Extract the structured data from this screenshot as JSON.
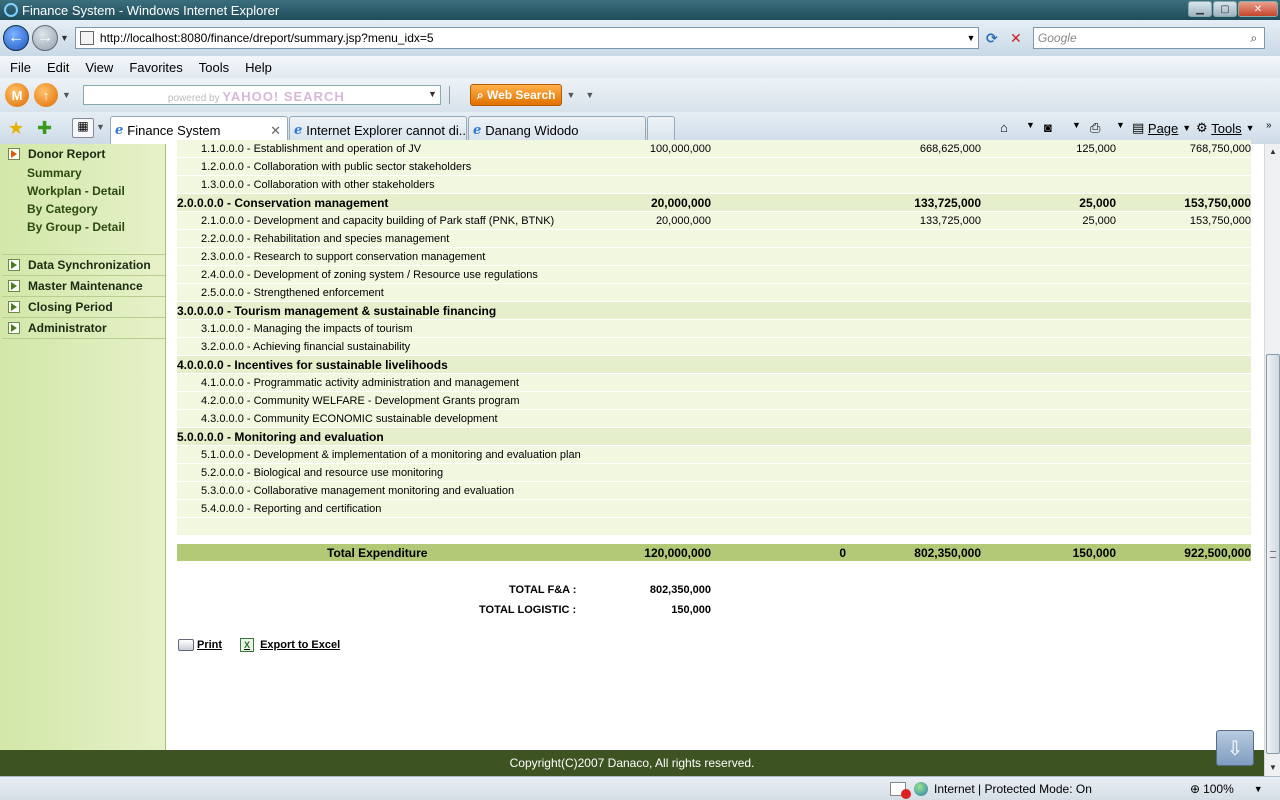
{
  "window": {
    "title": "Finance System - Windows Internet Explorer",
    "url": "http://localhost:8080/finance/dreport/summary.jsp?menu_idx=5",
    "search_placeholder": "Google"
  },
  "menu": [
    "File",
    "Edit",
    "View",
    "Favorites",
    "Tools",
    "Help"
  ],
  "yahoo": {
    "powered_by": "powered by",
    "brand": "YAHOO! SEARCH",
    "web_search": "Web Search"
  },
  "tabs": [
    {
      "label": "Finance System",
      "active": true
    },
    {
      "label": "Internet Explorer cannot di...",
      "active": false
    },
    {
      "label": "Danang Widodo",
      "active": false
    }
  ],
  "commands": {
    "page": "Page",
    "tools": "Tools"
  },
  "sidebar": {
    "donor_report": "Donor Report",
    "sub_items": [
      "Summary",
      "Workplan - Detail",
      "By Category",
      "By Group - Detail"
    ],
    "sections": [
      "Data Synchronization",
      "Master Maintenance",
      "Closing Period",
      "Administrator"
    ]
  },
  "report": {
    "rows": [
      {
        "type": "item",
        "label": "1.1.0.0.0 - Establishment and operation of JV",
        "c1": "100,000,000",
        "c2": "",
        "c3": "668,625,000",
        "c4": "125,000",
        "c5": "768,750,000"
      },
      {
        "type": "item",
        "label": "1.2.0.0.0 - Collaboration with public sector stakeholders",
        "c1": "",
        "c2": "",
        "c3": "",
        "c4": "",
        "c5": ""
      },
      {
        "type": "item",
        "label": "1.3.0.0.0 - Collaboration with other stakeholders",
        "c1": "",
        "c2": "",
        "c3": "",
        "c4": "",
        "c5": ""
      },
      {
        "type": "group",
        "label": "2.0.0.0.0 - Conservation management",
        "c1": "20,000,000",
        "c2": "",
        "c3": "133,725,000",
        "c4": "25,000",
        "c5": "153,750,000"
      },
      {
        "type": "item",
        "label": "2.1.0.0.0 - Development and capacity building of Park staff (PNK, BTNK)",
        "c1": "20,000,000",
        "c2": "",
        "c3": "133,725,000",
        "c4": "25,000",
        "c5": "153,750,000"
      },
      {
        "type": "item",
        "label": "2.2.0.0.0 - Rehabilitation and species management",
        "c1": "",
        "c2": "",
        "c3": "",
        "c4": "",
        "c5": ""
      },
      {
        "type": "item",
        "label": "2.3.0.0.0 - Research to support conservation management",
        "c1": "",
        "c2": "",
        "c3": "",
        "c4": "",
        "c5": ""
      },
      {
        "type": "item",
        "label": "2.4.0.0.0 - Development of zoning system / Resource use regulations",
        "c1": "",
        "c2": "",
        "c3": "",
        "c4": "",
        "c5": ""
      },
      {
        "type": "item",
        "label": "2.5.0.0.0 - Strengthened enforcement",
        "c1": "",
        "c2": "",
        "c3": "",
        "c4": "",
        "c5": ""
      },
      {
        "type": "group",
        "label": "3.0.0.0.0 - Tourism management & sustainable financing",
        "c1": "",
        "c2": "",
        "c3": "",
        "c4": "",
        "c5": ""
      },
      {
        "type": "item",
        "label": "3.1.0.0.0 - Managing the impacts of tourism",
        "c1": "",
        "c2": "",
        "c3": "",
        "c4": "",
        "c5": ""
      },
      {
        "type": "item",
        "label": "3.2.0.0.0 - Achieving financial sustainability",
        "c1": "",
        "c2": "",
        "c3": "",
        "c4": "",
        "c5": ""
      },
      {
        "type": "group",
        "label": "4.0.0.0.0 - Incentives for sustainable livelihoods",
        "c1": "",
        "c2": "",
        "c3": "",
        "c4": "",
        "c5": ""
      },
      {
        "type": "item",
        "label": "4.1.0.0.0 - Programmatic activity administration and management",
        "c1": "",
        "c2": "",
        "c3": "",
        "c4": "",
        "c5": ""
      },
      {
        "type": "item",
        "label": "4.2.0.0.0 - Community WELFARE - Development Grants program",
        "c1": "",
        "c2": "",
        "c3": "",
        "c4": "",
        "c5": ""
      },
      {
        "type": "item",
        "label": "4.3.0.0.0 - Community ECONOMIC sustainable development",
        "c1": "",
        "c2": "",
        "c3": "",
        "c4": "",
        "c5": ""
      },
      {
        "type": "group",
        "label": "5.0.0.0.0 - Monitoring and evaluation",
        "c1": "",
        "c2": "",
        "c3": "",
        "c4": "",
        "c5": ""
      },
      {
        "type": "item",
        "label": "5.1.0.0.0 - Development & implementation of a monitoring and evaluation plan",
        "c1": "",
        "c2": "",
        "c3": "",
        "c4": "",
        "c5": ""
      },
      {
        "type": "item",
        "label": "5.2.0.0.0 - Biological and resource use monitoring",
        "c1": "",
        "c2": "",
        "c3": "",
        "c4": "",
        "c5": ""
      },
      {
        "type": "item",
        "label": "5.3.0.0.0 - Collaborative management monitoring and evaluation",
        "c1": "",
        "c2": "",
        "c3": "",
        "c4": "",
        "c5": ""
      },
      {
        "type": "item",
        "label": "5.4.0.0.0 - Reporting and certification",
        "c1": "",
        "c2": "",
        "c3": "",
        "c4": "",
        "c5": ""
      },
      {
        "type": "blank",
        "label": "",
        "c1": "",
        "c2": "",
        "c3": "",
        "c4": "",
        "c5": ""
      }
    ],
    "total": {
      "label": "Total Expenditure",
      "c1": "120,000,000",
      "c2": "0",
      "c3": "802,350,000",
      "c4": "150,000",
      "c5": "922,500,000"
    },
    "total_fa_label": "TOTAL F&A :",
    "total_fa_value": "802,350,000",
    "total_logistic_label": "TOTAL LOGISTIC :",
    "total_logistic_value": "150,000"
  },
  "actions": {
    "print": "Print",
    "export": "Export to Excel"
  },
  "footer": "Copyright(C)2007 Danaco, All rights reserved.",
  "status": {
    "zone": "Internet | Protected Mode: On",
    "zoom": "100%"
  }
}
